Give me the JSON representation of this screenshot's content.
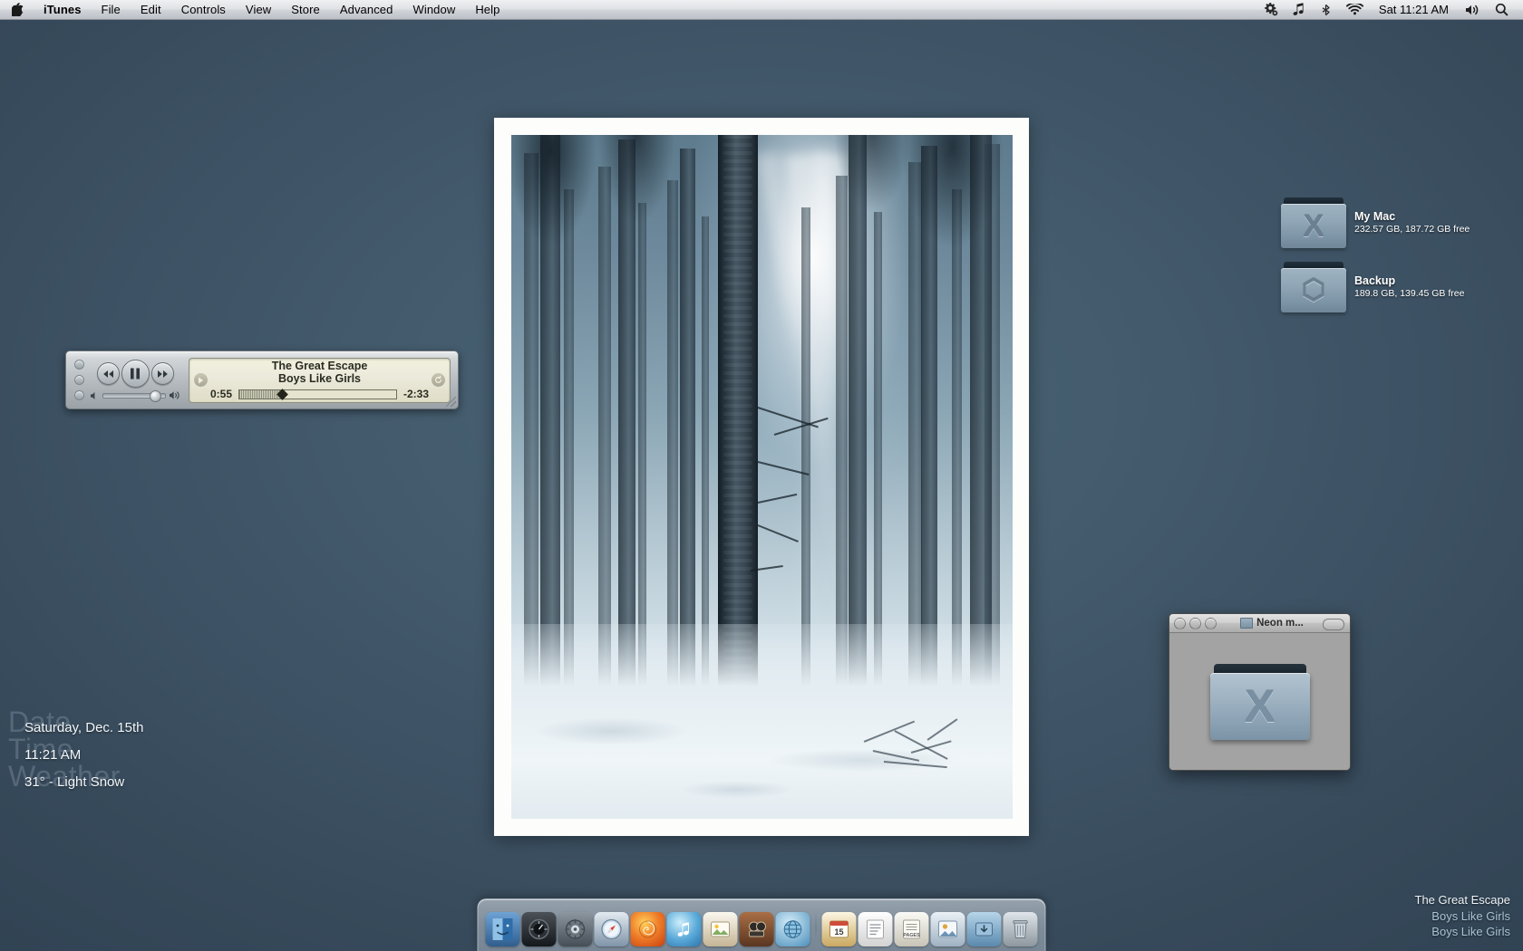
{
  "menubar": {
    "apple_icon": "apple-logo-icon",
    "items": [
      {
        "label": "iTunes",
        "active": true
      },
      {
        "label": "File",
        "active": false
      },
      {
        "label": "Edit",
        "active": false
      },
      {
        "label": "Controls",
        "active": false
      },
      {
        "label": "View",
        "active": false
      },
      {
        "label": "Store",
        "active": false
      },
      {
        "label": "Advanced",
        "active": false
      },
      {
        "label": "Window",
        "active": false
      },
      {
        "label": "Help",
        "active": false
      }
    ],
    "status_icons": [
      "gear-icon",
      "music-note-icon",
      "bluetooth-icon",
      "wifi-icon"
    ],
    "clock": "Sat 11:21 AM",
    "trailing_icons": [
      "volume-icon",
      "spotlight-search-icon"
    ]
  },
  "itunes_widget": {
    "name": "iTunes mini controller",
    "track_title": "The Great Escape",
    "track_artist": "Boys Like Girls",
    "elapsed": "0:55",
    "remaining": "-2:33",
    "progress_percent": 27,
    "volume_percent": 75,
    "playing": true,
    "buttons": {
      "previous": "rewind-icon",
      "playpause": "pause-icon",
      "next": "fast-forward-icon",
      "lcd_left": "play-small-icon",
      "lcd_right": "repeat-icon"
    }
  },
  "drives": [
    {
      "name": "My Mac",
      "info": "232.57 GB, 187.72 GB free",
      "glyph": "X"
    },
    {
      "name": "Backup",
      "info": "189.8 GB, 139.45 GB free",
      "glyph": "⬡"
    }
  ],
  "finder_window": {
    "title": "Neon m...",
    "folder_glyph": "X",
    "buttons": [
      "close-button",
      "minimize-button",
      "zoom-button"
    ]
  },
  "geektool": {
    "rows": [
      {
        "ghost": "Date",
        "value": "Saturday, Dec. 15th"
      },
      {
        "ghost": "Time",
        "value": "11:21 AM"
      },
      {
        "ghost": "Weather",
        "value": "31° - Light Snow"
      }
    ]
  },
  "nowplaying_overlay": {
    "line1": "The Great Escape",
    "line2": "Boys Like Girls",
    "line3": "Boys Like Girls"
  },
  "dock": {
    "items": [
      {
        "name": "finder",
        "label": "",
        "color1": "#4b7fb5",
        "color2": "#2f5d8e",
        "running": true
      },
      {
        "name": "dashboard",
        "label": "",
        "color1": "#3a3f45",
        "color2": "#14181c",
        "running": false
      },
      {
        "name": "system-preferences",
        "label": "",
        "color1": "#7d8793",
        "color2": "#474f58",
        "running": false
      },
      {
        "name": "safari",
        "label": "",
        "color1": "#d3dce4",
        "color2": "#7f94a8",
        "running": false
      },
      {
        "name": "firefox",
        "label": "",
        "color1": "#f09032",
        "color2": "#c34a16",
        "running": false
      },
      {
        "name": "itunes",
        "label": "",
        "color1": "#9fd8ef",
        "color2": "#3d91c9",
        "running": true
      },
      {
        "name": "iphoto",
        "label": "",
        "color1": "#f2efe6",
        "color2": "#b7a98c",
        "running": false
      },
      {
        "name": "imovie",
        "label": "",
        "color1": "#8f5a38",
        "color2": "#5a3520",
        "running": false
      },
      {
        "name": "iweb",
        "label": "",
        "color1": "#9ccbe6",
        "color2": "#4b8fba",
        "running": true
      },
      {
        "name": "separator",
        "label": "",
        "color1": "",
        "color2": "",
        "running": false
      },
      {
        "name": "ical",
        "label": "",
        "color1": "#f4e7c8",
        "color2": "#c9a860",
        "running": false
      },
      {
        "name": "textedit",
        "label": "",
        "color1": "#fafafa",
        "color2": "#d2d2d2",
        "running": false
      },
      {
        "name": "pages",
        "label": "PAGES",
        "color1": "#f4f3ef",
        "color2": "#c8c4b6",
        "running": false
      },
      {
        "name": "preview",
        "label": "",
        "color1": "#e2e9ef",
        "color2": "#9fb2c2",
        "running": false
      },
      {
        "name": "stacks-downloads",
        "label": "",
        "color1": "#9ec4de",
        "color2": "#5a89ad",
        "running": false
      },
      {
        "name": "trash",
        "label": "",
        "color1": "#cfd6db",
        "color2": "#8d979e",
        "running": false
      }
    ]
  }
}
